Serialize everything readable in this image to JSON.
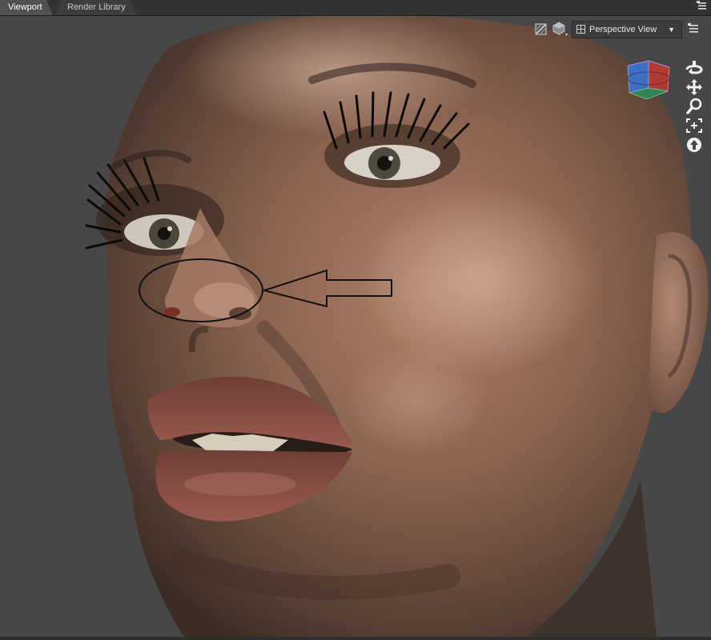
{
  "tabs": [
    {
      "label": "Viewport",
      "active": true
    },
    {
      "label": "Render Library",
      "active": false
    }
  ],
  "viewport": {
    "camera_select": "Perspective View",
    "background_color": "#474747",
    "top_icons": [
      "draw-style-icon",
      "shading-mode-icon"
    ],
    "right_tools": [
      "orbit-icon",
      "pan-icon",
      "zoom-icon",
      "frame-icon",
      "reset-view-icon"
    ],
    "nav_cube_colors": [
      "#3d7bd6",
      "#c0392b",
      "#2e8b57"
    ]
  },
  "annotation": {
    "shape": "ellipse-with-arrow",
    "color": "#111111"
  }
}
